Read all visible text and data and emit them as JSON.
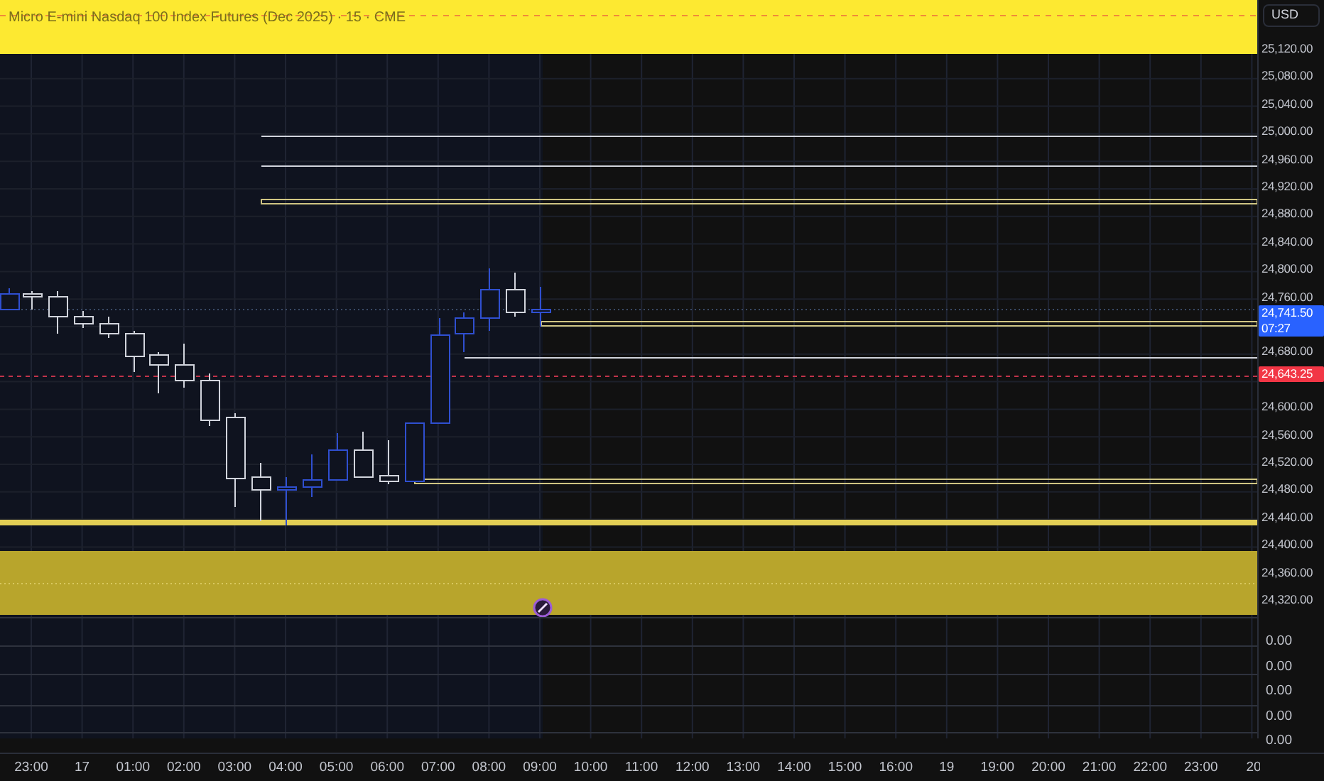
{
  "chart": {
    "title": "Micro E-mini Nasdaq 100 Index Futures (Dec 2025) · 15 · CME"
  },
  "price_axis": {
    "currency": "USD",
    "labels": [
      "25,120.00",
      "25,080.00",
      "25,040.00",
      "25,000.00",
      "24,960.00",
      "24,920.00",
      "24,880.00",
      "24,840.00",
      "24,800.00",
      "24,760.00",
      "24,680.00",
      "24,600.00",
      "24,560.00",
      "24,520.00",
      "24,480.00",
      "24,440.00",
      "24,400.00",
      "24,360.00",
      "24,320.00"
    ],
    "tags": [
      {
        "price": "24,741.50",
        "countdown": "07:27",
        "color": "#2962ff"
      },
      {
        "price": "24,643.25",
        "color": "#f23645"
      }
    ]
  },
  "indicator_panes": [
    {
      "value": "0.00"
    },
    {
      "value": "0.00"
    },
    {
      "value": "0.00"
    },
    {
      "value": "0.00"
    },
    {
      "value": "0.00"
    }
  ],
  "time_axis": [
    "23:00",
    "17",
    "01:00",
    "02:00",
    "03:00",
    "04:00",
    "05:00",
    "06:00",
    "07:00",
    "08:00",
    "09:00",
    "10:00",
    "11:00",
    "12:00",
    "13:00",
    "14:00",
    "15:00",
    "16:00",
    "19",
    "19:00",
    "20:00",
    "21:00",
    "22:00",
    "23:00",
    "20"
  ]
}
